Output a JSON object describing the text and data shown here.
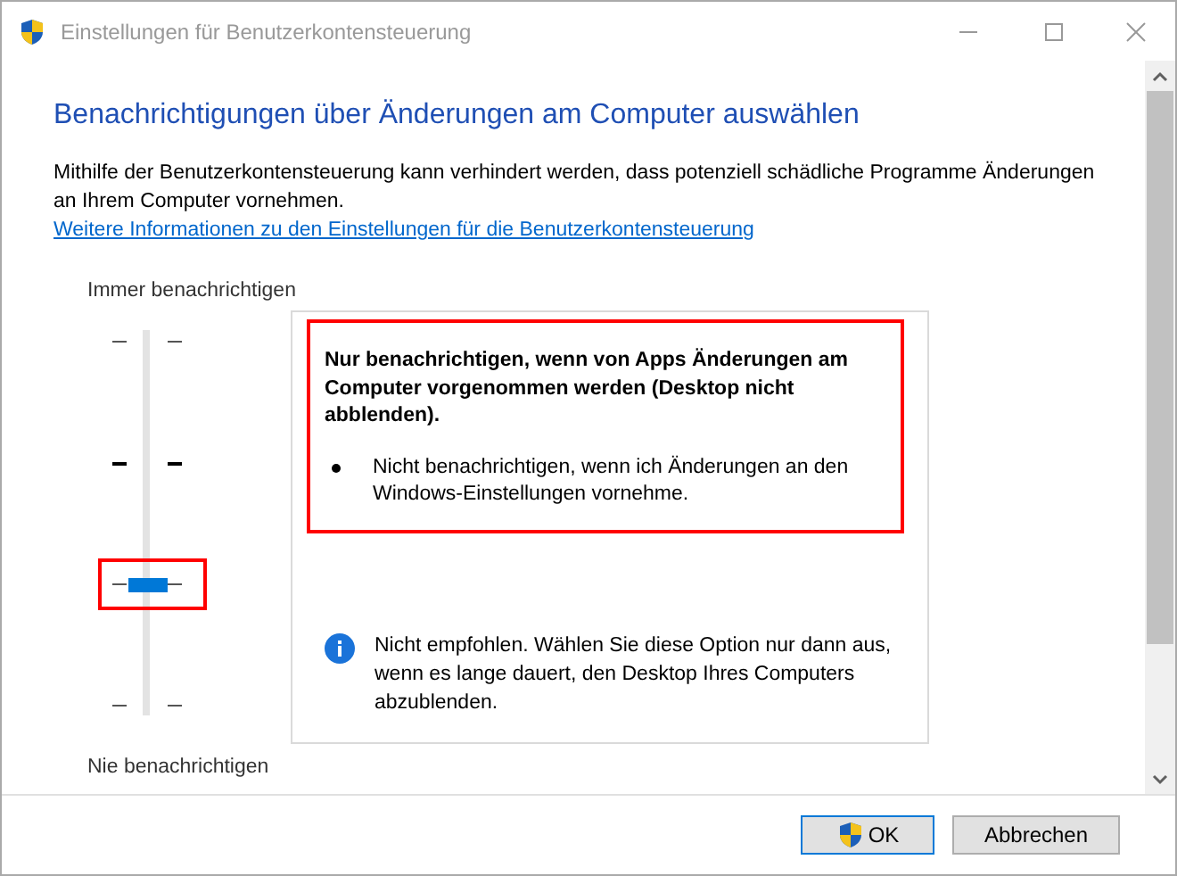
{
  "window": {
    "title": "Einstellungen für Benutzerkontensteuerung"
  },
  "heading": "Benachrichtigungen über Änderungen am Computer auswählen",
  "intro": "Mithilfe der Benutzerkontensteuerung kann verhindert werden, dass potenziell schädliche Programme Änderungen an Ihrem Computer vornehmen.",
  "link": "Weitere Informationen zu den Einstellungen für die Benutzerkontensteuerung",
  "slider": {
    "top_label": "Immer benachrichtigen",
    "bottom_label": "Nie benachrichtigen",
    "level": 0.3333,
    "highlighted": true
  },
  "description": {
    "title": "Nur benachrichtigen, wenn von Apps Änderungen am Computer vorgenommen werden (Desktop nicht abblenden).",
    "bullets": [
      "Nicht benachrichtigen, wenn ich Änderungen an den Windows-Einstellungen vornehme."
    ],
    "highlighted": true,
    "note": "Nicht empfohlen. Wählen Sie diese Option nur dann aus, wenn es lange dauert, den Desktop Ihres Computers abzublenden."
  },
  "buttons": [
    {
      "label": "OK",
      "kind": "shield",
      "default": true
    },
    {
      "label": "Abbrechen",
      "kind": "plain",
      "default": false
    }
  ]
}
